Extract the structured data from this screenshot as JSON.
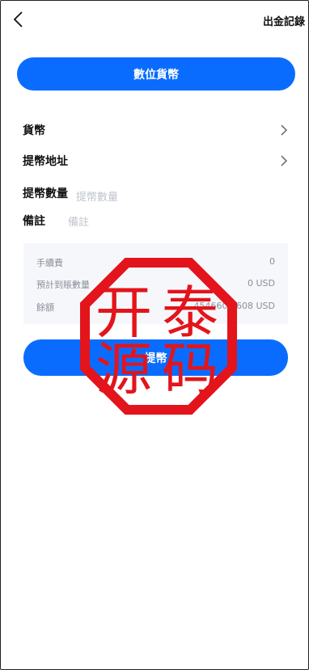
{
  "header": {
    "back_icon": "chevron-left-icon",
    "records_label": "出金記錄"
  },
  "currency_button_label": "數位貨幣",
  "form": {
    "currency_label": "貨幣",
    "address_label": "提幣地址",
    "amount_label": "提幣數量",
    "amount_placeholder": "提幣數量",
    "remark_label": "備註",
    "remark_placeholder": "備註"
  },
  "summary": {
    "fee_label": "手續費",
    "fee_value": "0",
    "expected_label": "預計到賬數量",
    "expected_value": "0 USD",
    "balance_label": "餘額",
    "balance_value": "4546609.608 USD"
  },
  "submit_label": "提幣",
  "watermark": {
    "text": "开泰源码",
    "color": "#e3141b"
  },
  "colors": {
    "accent": "#0a6cff",
    "placeholder": "#bfc4cc"
  }
}
